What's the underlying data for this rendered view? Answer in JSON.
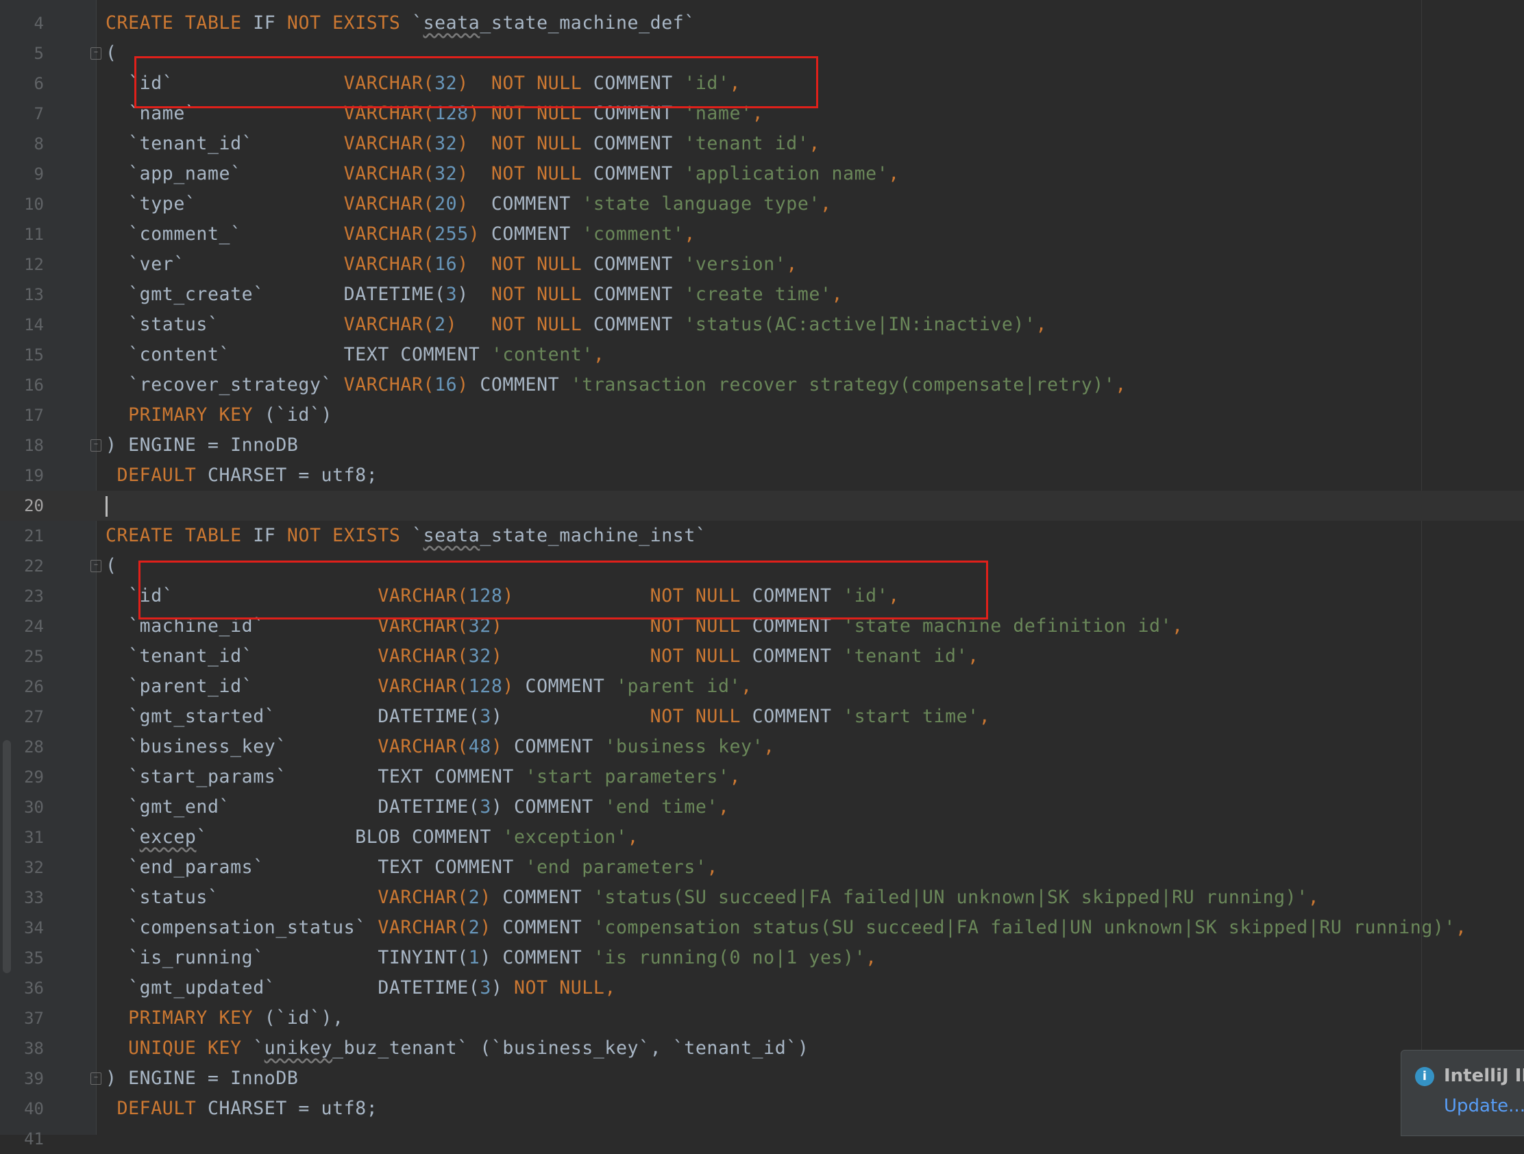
{
  "editor": {
    "lines": [
      {
        "num": "4",
        "tokens": [
          {
            "t": "CREATE TABLE ",
            "c": "kw"
          },
          {
            "t": "IF ",
            "c": "id"
          },
          {
            "t": "NOT EXISTS ",
            "c": "kw"
          },
          {
            "t": "`",
            "c": "id"
          },
          {
            "t": "seata",
            "c": "sq"
          },
          {
            "t": "_state_machine_def`",
            "c": "id"
          }
        ]
      },
      {
        "num": "5",
        "fold": true,
        "tokens": [
          {
            "t": "(",
            "c": "id"
          }
        ]
      },
      {
        "num": "6",
        "tokens": [
          {
            "t": "  `id`               ",
            "c": "id"
          },
          {
            "t": "VARCHAR(",
            "c": "kw"
          },
          {
            "t": "32",
            "c": "num"
          },
          {
            "t": ")  ",
            "c": "kw"
          },
          {
            "t": "NOT NULL ",
            "c": "kw"
          },
          {
            "t": "COMMENT ",
            "c": "id"
          },
          {
            "t": "'id'",
            "c": "str"
          },
          {
            "t": ",",
            "c": "kw"
          }
        ]
      },
      {
        "num": "7",
        "tokens": [
          {
            "t": "  `name`             ",
            "c": "id"
          },
          {
            "t": "VARCHAR(",
            "c": "kw"
          },
          {
            "t": "128",
            "c": "num"
          },
          {
            "t": ") ",
            "c": "kw"
          },
          {
            "t": "NOT NULL ",
            "c": "kw"
          },
          {
            "t": "COMMENT ",
            "c": "id"
          },
          {
            "t": "'name'",
            "c": "str"
          },
          {
            "t": ",",
            "c": "kw"
          }
        ]
      },
      {
        "num": "8",
        "tokens": [
          {
            "t": "  `tenant_id`        ",
            "c": "id"
          },
          {
            "t": "VARCHAR(",
            "c": "kw"
          },
          {
            "t": "32",
            "c": "num"
          },
          {
            "t": ")  ",
            "c": "kw"
          },
          {
            "t": "NOT NULL ",
            "c": "kw"
          },
          {
            "t": "COMMENT ",
            "c": "id"
          },
          {
            "t": "'tenant id'",
            "c": "str"
          },
          {
            "t": ",",
            "c": "kw"
          }
        ]
      },
      {
        "num": "9",
        "tokens": [
          {
            "t": "  `app_name`         ",
            "c": "id"
          },
          {
            "t": "VARCHAR(",
            "c": "kw"
          },
          {
            "t": "32",
            "c": "num"
          },
          {
            "t": ")  ",
            "c": "kw"
          },
          {
            "t": "NOT NULL ",
            "c": "kw"
          },
          {
            "t": "COMMENT ",
            "c": "id"
          },
          {
            "t": "'application name'",
            "c": "str"
          },
          {
            "t": ",",
            "c": "kw"
          }
        ]
      },
      {
        "num": "10",
        "tokens": [
          {
            "t": "  `type`             ",
            "c": "id"
          },
          {
            "t": "VARCHAR(",
            "c": "kw"
          },
          {
            "t": "20",
            "c": "num"
          },
          {
            "t": ")  ",
            "c": "kw"
          },
          {
            "t": "COMMENT ",
            "c": "id"
          },
          {
            "t": "'state language type'",
            "c": "str"
          },
          {
            "t": ",",
            "c": "kw"
          }
        ]
      },
      {
        "num": "11",
        "tokens": [
          {
            "t": "  `comment_`         ",
            "c": "id"
          },
          {
            "t": "VARCHAR(",
            "c": "kw"
          },
          {
            "t": "255",
            "c": "num"
          },
          {
            "t": ") ",
            "c": "kw"
          },
          {
            "t": "COMMENT ",
            "c": "id"
          },
          {
            "t": "'comment'",
            "c": "str"
          },
          {
            "t": ",",
            "c": "kw"
          }
        ]
      },
      {
        "num": "12",
        "tokens": [
          {
            "t": "  `ver`              ",
            "c": "id"
          },
          {
            "t": "VARCHAR(",
            "c": "kw"
          },
          {
            "t": "16",
            "c": "num"
          },
          {
            "t": ")  ",
            "c": "kw"
          },
          {
            "t": "NOT NULL ",
            "c": "kw"
          },
          {
            "t": "COMMENT ",
            "c": "id"
          },
          {
            "t": "'version'",
            "c": "str"
          },
          {
            "t": ",",
            "c": "kw"
          }
        ]
      },
      {
        "num": "13",
        "tokens": [
          {
            "t": "  `gmt_create`       ",
            "c": "id"
          },
          {
            "t": "DATETIME(",
            "c": "id"
          },
          {
            "t": "3",
            "c": "num"
          },
          {
            "t": ")  ",
            "c": "id"
          },
          {
            "t": "NOT NULL ",
            "c": "kw"
          },
          {
            "t": "COMMENT ",
            "c": "id"
          },
          {
            "t": "'create time'",
            "c": "str"
          },
          {
            "t": ",",
            "c": "kw"
          }
        ]
      },
      {
        "num": "14",
        "tokens": [
          {
            "t": "  `status`           ",
            "c": "id"
          },
          {
            "t": "VARCHAR(",
            "c": "kw"
          },
          {
            "t": "2",
            "c": "num"
          },
          {
            "t": ")   ",
            "c": "kw"
          },
          {
            "t": "NOT NULL ",
            "c": "kw"
          },
          {
            "t": "COMMENT ",
            "c": "id"
          },
          {
            "t": "'status(AC:active|IN:inactive)'",
            "c": "str"
          },
          {
            "t": ",",
            "c": "kw"
          }
        ]
      },
      {
        "num": "15",
        "tokens": [
          {
            "t": "  `content`          ",
            "c": "id"
          },
          {
            "t": "TEXT COMMENT ",
            "c": "id"
          },
          {
            "t": "'content'",
            "c": "str"
          },
          {
            "t": ",",
            "c": "kw"
          }
        ]
      },
      {
        "num": "16",
        "tokens": [
          {
            "t": "  `recover_strategy` ",
            "c": "id"
          },
          {
            "t": "VARCHAR(",
            "c": "kw"
          },
          {
            "t": "16",
            "c": "num"
          },
          {
            "t": ") ",
            "c": "kw"
          },
          {
            "t": "COMMENT ",
            "c": "id"
          },
          {
            "t": "'transaction recover strategy(compensate|retry)'",
            "c": "str"
          },
          {
            "t": ",",
            "c": "kw"
          }
        ]
      },
      {
        "num": "17",
        "tokens": [
          {
            "t": "  ",
            "c": "id"
          },
          {
            "t": "PRIMARY KEY ",
            "c": "kw"
          },
          {
            "t": "(`id`)",
            "c": "id"
          }
        ]
      },
      {
        "num": "18",
        "fold": true,
        "tokens": [
          {
            "t": ") ENGINE = InnoDB",
            "c": "id"
          }
        ]
      },
      {
        "num": "19",
        "tokens": [
          {
            "t": " ",
            "c": "id"
          },
          {
            "t": "DEFAULT ",
            "c": "kw"
          },
          {
            "t": "CHARSET = utf8;",
            "c": "id"
          }
        ]
      },
      {
        "num": "20",
        "current": true,
        "tokens": []
      },
      {
        "num": "21",
        "tokens": [
          {
            "t": "CREATE TABLE ",
            "c": "kw"
          },
          {
            "t": "IF ",
            "c": "id"
          },
          {
            "t": "NOT EXISTS ",
            "c": "kw"
          },
          {
            "t": "`",
            "c": "id"
          },
          {
            "t": "seata",
            "c": "sq"
          },
          {
            "t": "_state_machine_inst`",
            "c": "id"
          }
        ]
      },
      {
        "num": "22",
        "fold": true,
        "tokens": [
          {
            "t": "(",
            "c": "id"
          }
        ]
      },
      {
        "num": "23",
        "tokens": [
          {
            "t": "  `id`                  ",
            "c": "id"
          },
          {
            "t": "VARCHAR(",
            "c": "kw"
          },
          {
            "t": "128",
            "c": "num"
          },
          {
            "t": ")            ",
            "c": "kw"
          },
          {
            "t": "NOT NULL ",
            "c": "kw"
          },
          {
            "t": "COMMENT ",
            "c": "id"
          },
          {
            "t": "'id'",
            "c": "str"
          },
          {
            "t": ",",
            "c": "kw"
          }
        ]
      },
      {
        "num": "24",
        "tokens": [
          {
            "t": "  `machine_id`          ",
            "c": "id"
          },
          {
            "t": "VARCHAR(",
            "c": "kw"
          },
          {
            "t": "32",
            "c": "num"
          },
          {
            "t": ")             ",
            "c": "kw"
          },
          {
            "t": "NOT NULL ",
            "c": "kw"
          },
          {
            "t": "COMMENT ",
            "c": "id"
          },
          {
            "t": "'state machine definition id'",
            "c": "str"
          },
          {
            "t": ",",
            "c": "kw"
          }
        ]
      },
      {
        "num": "25",
        "tokens": [
          {
            "t": "  `tenant_id`           ",
            "c": "id"
          },
          {
            "t": "VARCHAR(",
            "c": "kw"
          },
          {
            "t": "32",
            "c": "num"
          },
          {
            "t": ")             ",
            "c": "kw"
          },
          {
            "t": "NOT NULL ",
            "c": "kw"
          },
          {
            "t": "COMMENT ",
            "c": "id"
          },
          {
            "t": "'tenant id'",
            "c": "str"
          },
          {
            "t": ",",
            "c": "kw"
          }
        ]
      },
      {
        "num": "26",
        "tokens": [
          {
            "t": "  `parent_id`           ",
            "c": "id"
          },
          {
            "t": "VARCHAR(",
            "c": "kw"
          },
          {
            "t": "128",
            "c": "num"
          },
          {
            "t": ") ",
            "c": "kw"
          },
          {
            "t": "COMMENT ",
            "c": "id"
          },
          {
            "t": "'parent id'",
            "c": "str"
          },
          {
            "t": ",",
            "c": "kw"
          }
        ]
      },
      {
        "num": "27",
        "tokens": [
          {
            "t": "  `gmt_started`         ",
            "c": "id"
          },
          {
            "t": "DATETIME(",
            "c": "id"
          },
          {
            "t": "3",
            "c": "num"
          },
          {
            "t": ")             ",
            "c": "id"
          },
          {
            "t": "NOT NULL ",
            "c": "kw"
          },
          {
            "t": "COMMENT ",
            "c": "id"
          },
          {
            "t": "'start time'",
            "c": "str"
          },
          {
            "t": ",",
            "c": "kw"
          }
        ]
      },
      {
        "num": "28",
        "tokens": [
          {
            "t": "  `business_key`        ",
            "c": "id"
          },
          {
            "t": "VARCHAR(",
            "c": "kw"
          },
          {
            "t": "48",
            "c": "num"
          },
          {
            "t": ") ",
            "c": "kw"
          },
          {
            "t": "COMMENT ",
            "c": "id"
          },
          {
            "t": "'business key'",
            "c": "str"
          },
          {
            "t": ",",
            "c": "kw"
          }
        ]
      },
      {
        "num": "29",
        "tokens": [
          {
            "t": "  `start_params`        ",
            "c": "id"
          },
          {
            "t": "TEXT COMMENT ",
            "c": "id"
          },
          {
            "t": "'start parameters'",
            "c": "str"
          },
          {
            "t": ",",
            "c": "kw"
          }
        ]
      },
      {
        "num": "30",
        "tokens": [
          {
            "t": "  `gmt_end`             ",
            "c": "id"
          },
          {
            "t": "DATETIME(",
            "c": "id"
          },
          {
            "t": "3",
            "c": "num"
          },
          {
            "t": ") COMMENT ",
            "c": "id"
          },
          {
            "t": "'end time'",
            "c": "str"
          },
          {
            "t": ",",
            "c": "kw"
          }
        ]
      },
      {
        "num": "31",
        "tokens": [
          {
            "t": "  `",
            "c": "id"
          },
          {
            "t": "excep",
            "c": "sq"
          },
          {
            "t": "`             ",
            "c": "id"
          },
          {
            "t": "BLOB COMMENT ",
            "c": "id"
          },
          {
            "t": "'exception'",
            "c": "str"
          },
          {
            "t": ",",
            "c": "kw"
          }
        ]
      },
      {
        "num": "32",
        "tokens": [
          {
            "t": "  `end_params`          ",
            "c": "id"
          },
          {
            "t": "TEXT COMMENT ",
            "c": "id"
          },
          {
            "t": "'end parameters'",
            "c": "str"
          },
          {
            "t": ",",
            "c": "kw"
          }
        ]
      },
      {
        "num": "33",
        "tokens": [
          {
            "t": "  `status`              ",
            "c": "id"
          },
          {
            "t": "VARCHAR(",
            "c": "kw"
          },
          {
            "t": "2",
            "c": "num"
          },
          {
            "t": ") ",
            "c": "kw"
          },
          {
            "t": "COMMENT ",
            "c": "id"
          },
          {
            "t": "'status(SU succeed|FA failed|UN unknown|SK skipped|RU running)'",
            "c": "str"
          },
          {
            "t": ",",
            "c": "kw"
          }
        ]
      },
      {
        "num": "34",
        "tokens": [
          {
            "t": "  `compensation_status` ",
            "c": "id"
          },
          {
            "t": "VARCHAR(",
            "c": "kw"
          },
          {
            "t": "2",
            "c": "num"
          },
          {
            "t": ") ",
            "c": "kw"
          },
          {
            "t": "COMMENT ",
            "c": "id"
          },
          {
            "t": "'compensation status(SU succeed|FA failed|UN unknown|SK skipped|RU running)'",
            "c": "str"
          },
          {
            "t": ",",
            "c": "kw"
          }
        ]
      },
      {
        "num": "35",
        "tokens": [
          {
            "t": "  `is_running`          ",
            "c": "id"
          },
          {
            "t": "TINYINT(",
            "c": "id"
          },
          {
            "t": "1",
            "c": "num"
          },
          {
            "t": ") COMMENT ",
            "c": "id"
          },
          {
            "t": "'is running(0 no|1 yes)'",
            "c": "str"
          },
          {
            "t": ",",
            "c": "kw"
          }
        ]
      },
      {
        "num": "36",
        "tokens": [
          {
            "t": "  `gmt_updated`         ",
            "c": "id"
          },
          {
            "t": "DATETIME(",
            "c": "id"
          },
          {
            "t": "3",
            "c": "num"
          },
          {
            "t": ") ",
            "c": "id"
          },
          {
            "t": "NOT NULL",
            "c": "kw"
          },
          {
            "t": ",",
            "c": "kw"
          }
        ]
      },
      {
        "num": "37",
        "tokens": [
          {
            "t": "  ",
            "c": "id"
          },
          {
            "t": "PRIMARY KEY ",
            "c": "kw"
          },
          {
            "t": "(`id`),",
            "c": "id"
          }
        ]
      },
      {
        "num": "38",
        "tokens": [
          {
            "t": "  ",
            "c": "id"
          },
          {
            "t": "UNIQUE KEY ",
            "c": "kw"
          },
          {
            "t": "`",
            "c": "id"
          },
          {
            "t": "unikey",
            "c": "sq"
          },
          {
            "t": "_buz_tenant` (`business_key`, `tenant_id`)",
            "c": "id"
          }
        ]
      },
      {
        "num": "39",
        "fold": true,
        "tokens": [
          {
            "t": ") ENGINE = InnoDB",
            "c": "id"
          }
        ]
      },
      {
        "num": "40",
        "tokens": [
          {
            "t": " ",
            "c": "id"
          },
          {
            "t": "DEFAULT ",
            "c": "kw"
          },
          {
            "t": "CHARSET = utf8;",
            "c": "id"
          }
        ]
      },
      {
        "num": "41",
        "tokens": []
      }
    ]
  },
  "notification": {
    "title": "IntelliJ IDEA",
    "link": "Update...",
    "icon": "info-icon"
  },
  "colors": {
    "keyword": "#cc7832",
    "number": "#6897bb",
    "string": "#6a8759",
    "identifier": "#a9b7c6",
    "highlight_box": "#e0201a",
    "background": "#2b2b2b"
  }
}
